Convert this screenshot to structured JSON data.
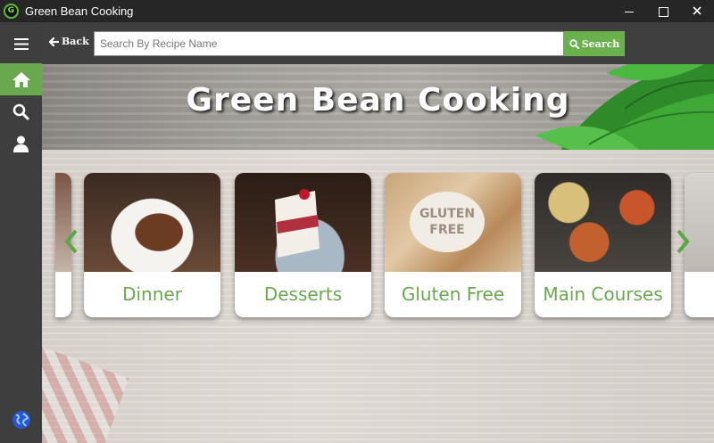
{
  "window": {
    "title": "Green Bean Cooking",
    "app_icon_text": "G"
  },
  "toolbar": {
    "back_label": "Back",
    "search_placeholder": "Search By Recipe Name",
    "search_value": "",
    "search_button_label": "Search"
  },
  "banner": {
    "title": "Green Bean Cooking"
  },
  "categories": [
    {
      "label": "Dinner"
    },
    {
      "label": "Desserts"
    },
    {
      "label": "Gluten Free"
    },
    {
      "label": "Main Courses"
    }
  ],
  "gluten_photo_text": "GLUTEN FREE",
  "colors": {
    "accent": "#6aa84f",
    "sidebar": "#3e3e3e",
    "titlebar": "#262626",
    "toolbar": "#3f3f3f"
  },
  "icons": {
    "sidebar": [
      "menu-icon",
      "home-icon",
      "search-icon",
      "user-icon",
      "globe-icon"
    ],
    "carousel": [
      "chevron-left-icon",
      "chevron-right-icon"
    ]
  }
}
